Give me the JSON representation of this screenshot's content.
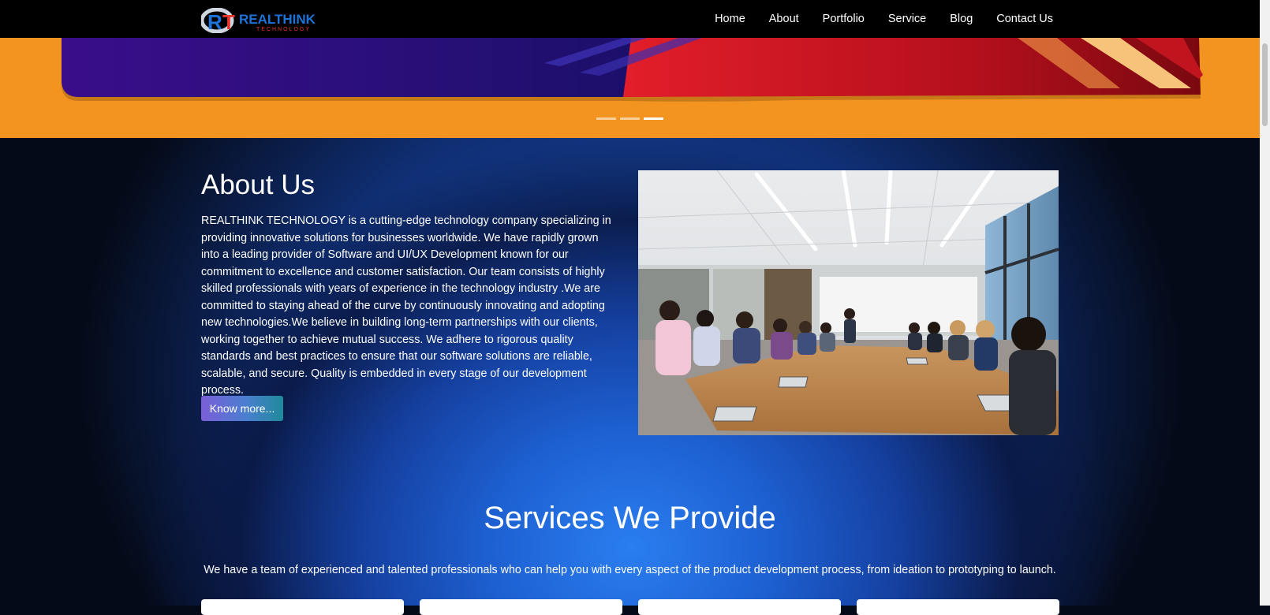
{
  "brand": {
    "logo_letter_r": "R",
    "logo_letter_t": "T",
    "logo_name": "REALTHINK",
    "logo_tagline": "TECHNOLOGY"
  },
  "nav": {
    "items": [
      {
        "label": "Home"
      },
      {
        "label": "About"
      },
      {
        "label": "Portfolio"
      },
      {
        "label": "Service"
      },
      {
        "label": "Blog"
      },
      {
        "label": "Contact Us"
      }
    ]
  },
  "hero": {
    "slides_total": 3,
    "active_slide": 3
  },
  "about": {
    "title": "About Us",
    "text": "REALTHINK TECHNOLOGY is a cutting-edge technology company specializing in providing innovative solutions for businesses worldwide. We have rapidly grown into a leading provider of Software and UI/UX Development known for our commitment to excellence and customer satisfaction. Our team consists of highly skilled professionals with years of experience in the technology industry .We are committed to staying ahead of the curve by continuously innovating and adopting new technologies.We believe in building long-term partnerships with our clients, working together to achieve mutual success. We adhere to rigorous quality standards and best practices to ensure that our software solutions are reliable, scalable, and secure. Quality is embedded in every stage of our development process.",
    "button_label": "Know more..."
  },
  "services": {
    "title": "Services We Provide",
    "subtitle": "We have a team of experienced and talented professionals who can help you with every aspect of the product development process, from ideation to prototyping to launch."
  },
  "colors": {
    "nav_bg": "#000000",
    "hero_orange": "#f39420",
    "accent_blue": "#2a7ef0",
    "logo_blue": "#1e73d8",
    "logo_red": "#e8362a"
  }
}
